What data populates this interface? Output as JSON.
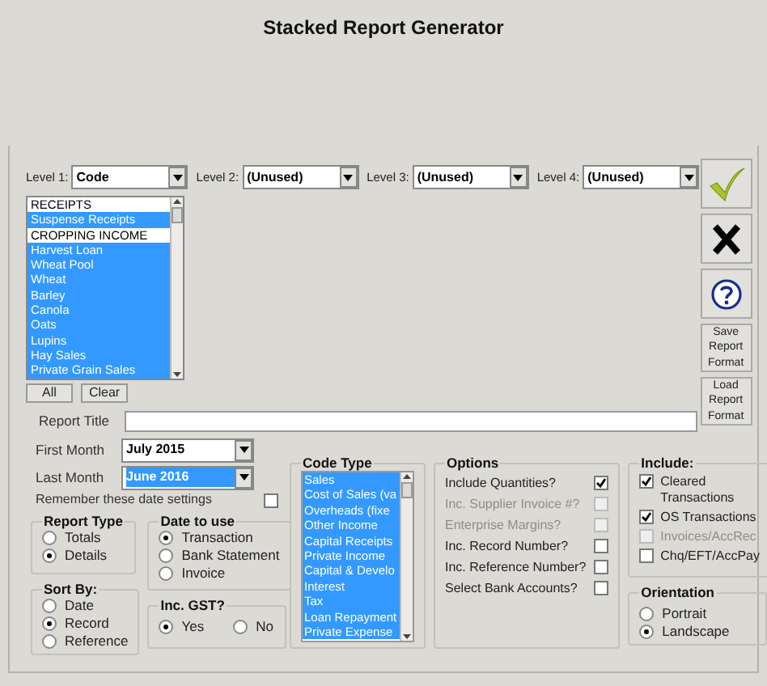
{
  "window": {
    "title": "Stacked Report Generator"
  },
  "levels": [
    {
      "label": "Level 1:",
      "value": "Code"
    },
    {
      "label": "Level 2:",
      "value": "(Unused)"
    },
    {
      "label": "Level 3:",
      "value": "(Unused)"
    },
    {
      "label": "Level 4:",
      "value": "(Unused)"
    }
  ],
  "code_list": [
    {
      "text": "RECEIPTS",
      "selected": false
    },
    {
      "text": "Suspense Receipts",
      "selected": true
    },
    {
      "text": "CROPPING INCOME",
      "selected": false
    },
    {
      "text": "Harvest Loan",
      "selected": true
    },
    {
      "text": "Wheat Pool",
      "selected": true
    },
    {
      "text": "Wheat",
      "selected": true
    },
    {
      "text": "Barley",
      "selected": true
    },
    {
      "text": "Canola",
      "selected": true
    },
    {
      "text": "Oats",
      "selected": true
    },
    {
      "text": "Lupins",
      "selected": true
    },
    {
      "text": "Hay Sales",
      "selected": true
    },
    {
      "text": "Private Grain Sales",
      "selected": true
    }
  ],
  "list_buttons": [
    "All",
    "Clear"
  ],
  "side_buttons": [
    {
      "kind": "ok"
    },
    {
      "kind": "cancel"
    },
    {
      "kind": "help"
    },
    {
      "kind": "text",
      "label": "Save Report Format"
    },
    {
      "kind": "text",
      "label": "Load Report Format"
    }
  ],
  "report_title": {
    "label": "Report Title"
  },
  "first_month": {
    "label": "First Month",
    "value": "July 2015",
    "selected": false
  },
  "last_month": {
    "label": "Last Month",
    "value": "June 2016",
    "selected": true
  },
  "remember": {
    "label": "Remember these date settings",
    "checked": false
  },
  "report_type": {
    "title": "Report Type",
    "options": [
      {
        "label": "Totals",
        "selected": false
      },
      {
        "label": "Details",
        "selected": true
      }
    ]
  },
  "date_to_use": {
    "title": "Date to use",
    "options": [
      {
        "label": "Transaction",
        "selected": true
      },
      {
        "label": "Bank Statement",
        "selected": false
      },
      {
        "label": "Invoice",
        "selected": false
      }
    ]
  },
  "sort_by": {
    "title": "Sort By:",
    "options": [
      {
        "label": "Date",
        "selected": false
      },
      {
        "label": "Record",
        "selected": true
      },
      {
        "label": "Reference",
        "selected": false
      }
    ]
  },
  "inc_gst": {
    "title": "Inc. GST?",
    "options": [
      {
        "label": "Yes",
        "selected": true
      },
      {
        "label": "No",
        "selected": false
      }
    ]
  },
  "code_type": {
    "title": "Code Type",
    "items": [
      {
        "text": "Sales",
        "selected": true
      },
      {
        "text": "Cost of Sales (va",
        "selected": true
      },
      {
        "text": "Overheads (fixe",
        "selected": true
      },
      {
        "text": "Other  Income",
        "selected": true
      },
      {
        "text": "Capital Receipts",
        "selected": true
      },
      {
        "text": "Private Income",
        "selected": true
      },
      {
        "text": "Capital & Develo",
        "selected": true
      },
      {
        "text": "Interest",
        "selected": true
      },
      {
        "text": "Tax",
        "selected": true
      },
      {
        "text": "Loan Repayment",
        "selected": true
      },
      {
        "text": "Private Expense",
        "selected": true
      }
    ]
  },
  "options": {
    "title": "Options",
    "items": [
      {
        "label": "Include Quantities?",
        "checked": true,
        "disabled": false
      },
      {
        "label": "Inc. Supplier Invoice #?",
        "checked": false,
        "disabled": true
      },
      {
        "label": "Enterprise Margins?",
        "checked": false,
        "disabled": true
      },
      {
        "label": "Inc. Record Number?",
        "checked": false,
        "disabled": false
      },
      {
        "label": "Inc. Reference Number?",
        "checked": false,
        "disabled": false
      },
      {
        "label": "Select Bank Accounts?",
        "checked": false,
        "disabled": false
      }
    ]
  },
  "include": {
    "title": "Include:",
    "items": [
      {
        "label": "Cleared Transactions",
        "checked": true,
        "disabled": false
      },
      {
        "label": "OS Transactions",
        "checked": true,
        "disabled": false
      },
      {
        "label": "Invoices/AccRec",
        "checked": false,
        "disabled": true
      },
      {
        "label": "Chq/EFT/AccPay",
        "checked": false,
        "disabled": false
      }
    ]
  },
  "orientation": {
    "title": "Orientation",
    "options": [
      {
        "label": "Portrait",
        "selected": false
      },
      {
        "label": "Landscape",
        "selected": true
      }
    ]
  }
}
